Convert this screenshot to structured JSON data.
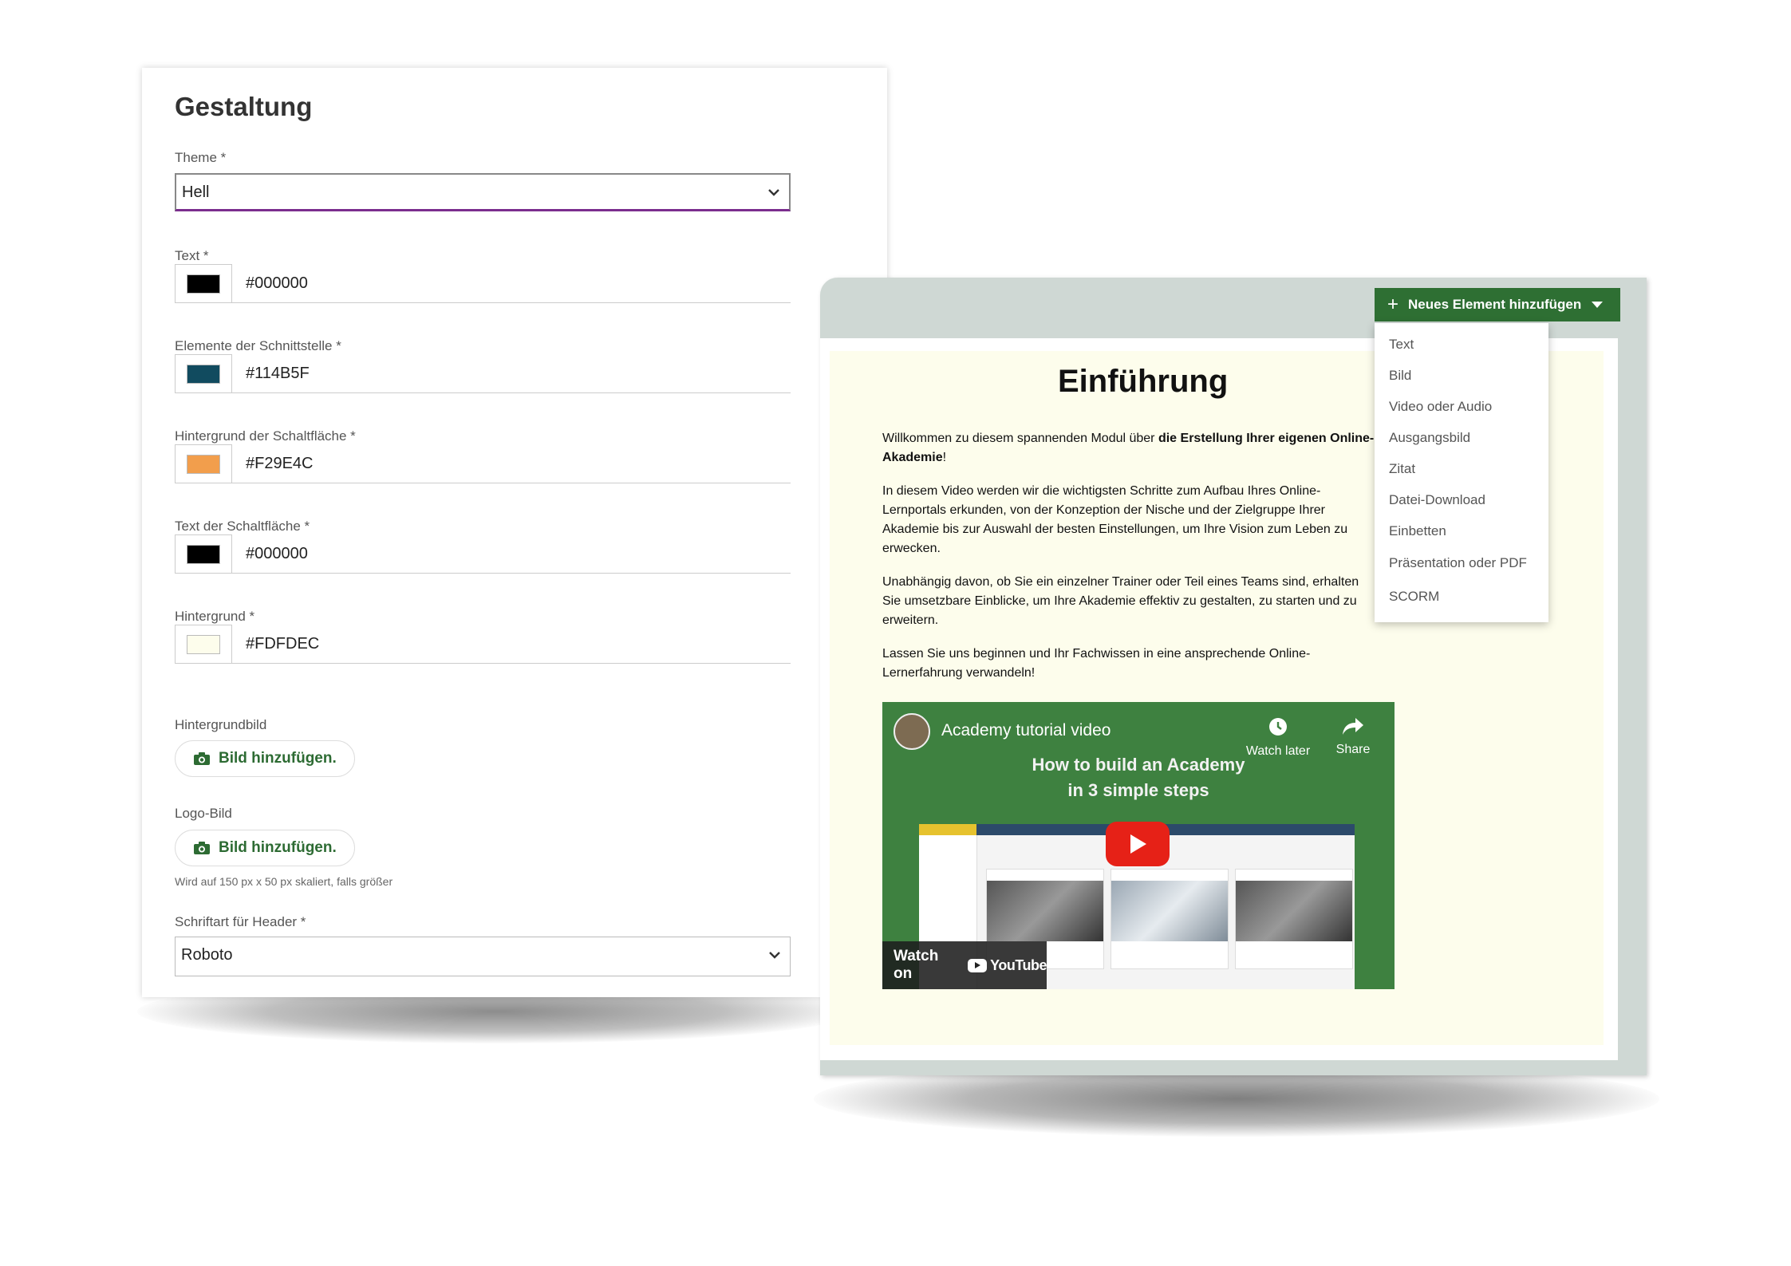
{
  "settings": {
    "title": "Gestaltung",
    "theme": {
      "label": "Theme *",
      "value": "Hell"
    },
    "colors": [
      {
        "label": "Text *",
        "hex": "#000000",
        "swatch": "#000000"
      },
      {
        "label": "Elemente der Schnittstelle *",
        "hex": "#114B5F",
        "swatch": "#114B5F"
      },
      {
        "label": "Hintergrund der Schaltfläche *",
        "hex": "#F29E4C",
        "swatch": "#F29E4C"
      },
      {
        "label": "Text der Schaltfläche *",
        "hex": "#000000",
        "swatch": "#000000"
      },
      {
        "label": "Hintergrund *",
        "hex": "#FDFDEC",
        "swatch": "#FDFDEC"
      }
    ],
    "background_image": {
      "label": "Hintergrundbild",
      "button": "Bild hinzufügen."
    },
    "logo_image": {
      "label": "Logo-Bild",
      "button": "Bild hinzufügen.",
      "hint": "Wird auf 150 px x 50 px skaliert, falls größer"
    },
    "header_font": {
      "label": "Schriftart für Header *",
      "value": "Roboto"
    }
  },
  "editor": {
    "add_button": "Neues Element hinzufügen",
    "menu_items": [
      "Text",
      "Bild",
      "Video oder Audio",
      "Ausgangsbild",
      "Zitat",
      "Datei-Download",
      "Einbetten",
      "Präsentation oder PDF",
      "SCORM"
    ],
    "page_title": "Einführung",
    "p1_a": "Willkommen zu diesem spannenden Modul über ",
    "p1_b": "die Erstellung Ihrer eigenen Online-Akademie",
    "p1_c": "!",
    "p2": "In diesem Video werden wir die wichtigsten Schritte zum Aufbau Ihres Online-Lernportals erkunden, von der Konzeption der Nische und der Zielgruppe Ihrer Akademie bis zur Auswahl der besten Einstellungen, um Ihre Vision zum Leben zu erwecken.",
    "p3": "Unabhängig davon, ob Sie ein einzelner Trainer oder Teil eines Teams sind, erhalten Sie umsetzbare Einblicke, um Ihre Akademie effektiv zu gestalten, zu starten und zu erweitern.",
    "p4": "Lassen Sie uns beginnen und Ihr Fachwissen in eine ansprechende Online-Lernerfahrung verwandeln!",
    "video": {
      "title": "Academy tutorial video",
      "headline1": "How to build an Academy",
      "headline2": "in 3 simple steps",
      "watch_later": "Watch later",
      "share": "Share",
      "watch_on": "Watch on",
      "youtube": "YouTube"
    }
  },
  "colors": {
    "accent_green": "#2E6F33",
    "editor_frame": "#CFD8D4",
    "page_bg": "#FDFDEC",
    "focus_underline": "#7B2D8E"
  }
}
